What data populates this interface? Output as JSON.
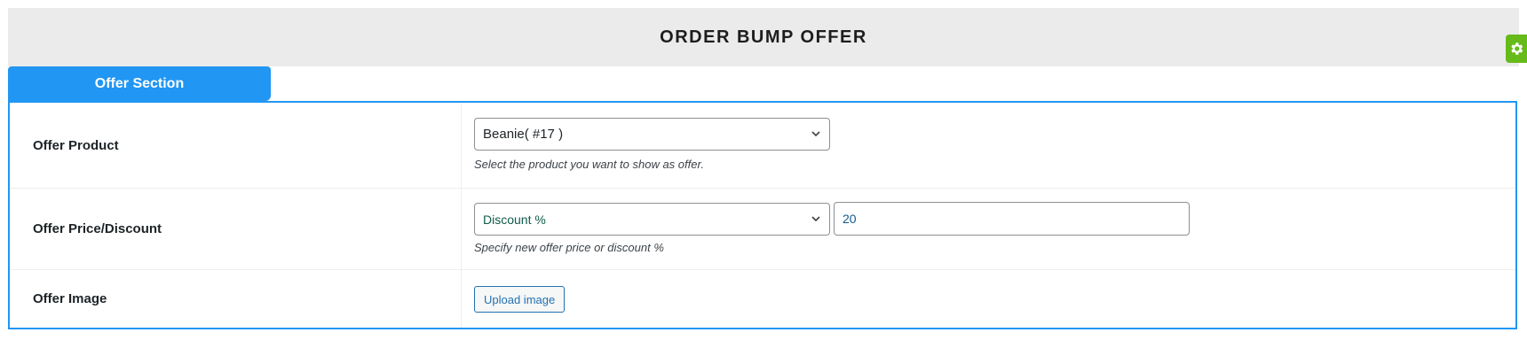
{
  "header": {
    "title": "ORDER BUMP OFFER"
  },
  "tabs": [
    {
      "label": "Offer Section"
    }
  ],
  "rows": {
    "product": {
      "label": "Offer Product",
      "select_value": "Beanie( #17 )",
      "description": "Select the product you want to show as offer."
    },
    "price": {
      "label": "Offer Price/Discount",
      "select_value": "Discount %",
      "input_value": "20",
      "description": "Specify new offer price or discount %"
    },
    "image": {
      "label": "Offer Image",
      "button_label": "Upload image"
    }
  },
  "colors": {
    "accent": "#2196f3",
    "gear_badge": "#66bb1a",
    "link_blue": "#2271b1"
  },
  "icons": [
    "chevron-down-icon",
    "gear-icon"
  ]
}
